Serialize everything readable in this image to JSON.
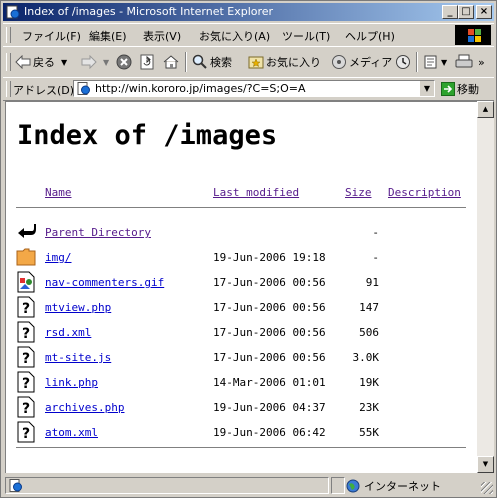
{
  "window": {
    "title": "Index of /images - Microsoft Internet Explorer",
    "min_symbol": "_",
    "max_symbol": "□",
    "close_symbol": "×"
  },
  "menu": [
    "ファイル(F)",
    "編集(E)",
    "表示(V)",
    "お気に入り(A)",
    "ツール(T)",
    "ヘルプ(H)"
  ],
  "toolbar": {
    "back_label": "戻る",
    "search_label": "検索",
    "favorites_label": "お気に入り",
    "media_label": "メディア"
  },
  "address": {
    "label": "アドレス(D)",
    "url": "http://win.kororo.jp/images/?C=S;O=A",
    "go_label": "移動"
  },
  "page": {
    "title": "Index of /images",
    "columns": {
      "name": "Name",
      "modified": "Last modified",
      "size": "Size",
      "description": "Description"
    },
    "rows": [
      {
        "icon": "back-icon",
        "name": "Parent Directory",
        "date": "",
        "size": "-"
      },
      {
        "icon": "folder-icon",
        "name": "img/",
        "date": "19-Jun-2006 19:18",
        "size": "-"
      },
      {
        "icon": "image-file-icon",
        "name": "nav-commenters.gif",
        "date": "17-Jun-2006 00:56",
        "size": "91"
      },
      {
        "icon": "unknown-file-icon",
        "name": "mtview.php",
        "date": "17-Jun-2006 00:56",
        "size": "147"
      },
      {
        "icon": "unknown-file-icon",
        "name": "rsd.xml",
        "date": "17-Jun-2006 00:56",
        "size": "506"
      },
      {
        "icon": "unknown-file-icon",
        "name": "mt-site.js",
        "date": "17-Jun-2006 00:56",
        "size": "3.0K"
      },
      {
        "icon": "unknown-file-icon",
        "name": "link.php",
        "date": "14-Mar-2006 01:01",
        "size": "19K"
      },
      {
        "icon": "unknown-file-icon",
        "name": "archives.php",
        "date": "19-Jun-2006 04:37",
        "size": "23K"
      },
      {
        "icon": "unknown-file-icon",
        "name": "atom.xml",
        "date": "19-Jun-2006 06:42",
        "size": "55K"
      }
    ]
  },
  "status": {
    "zone_label": "インターネット"
  },
  "colors": {
    "title_bar_start": "#0a246a",
    "title_bar_end": "#a6caf0",
    "link": "#0000cc",
    "visited_link": "#551a8b",
    "chrome": "#d4d0c8"
  }
}
